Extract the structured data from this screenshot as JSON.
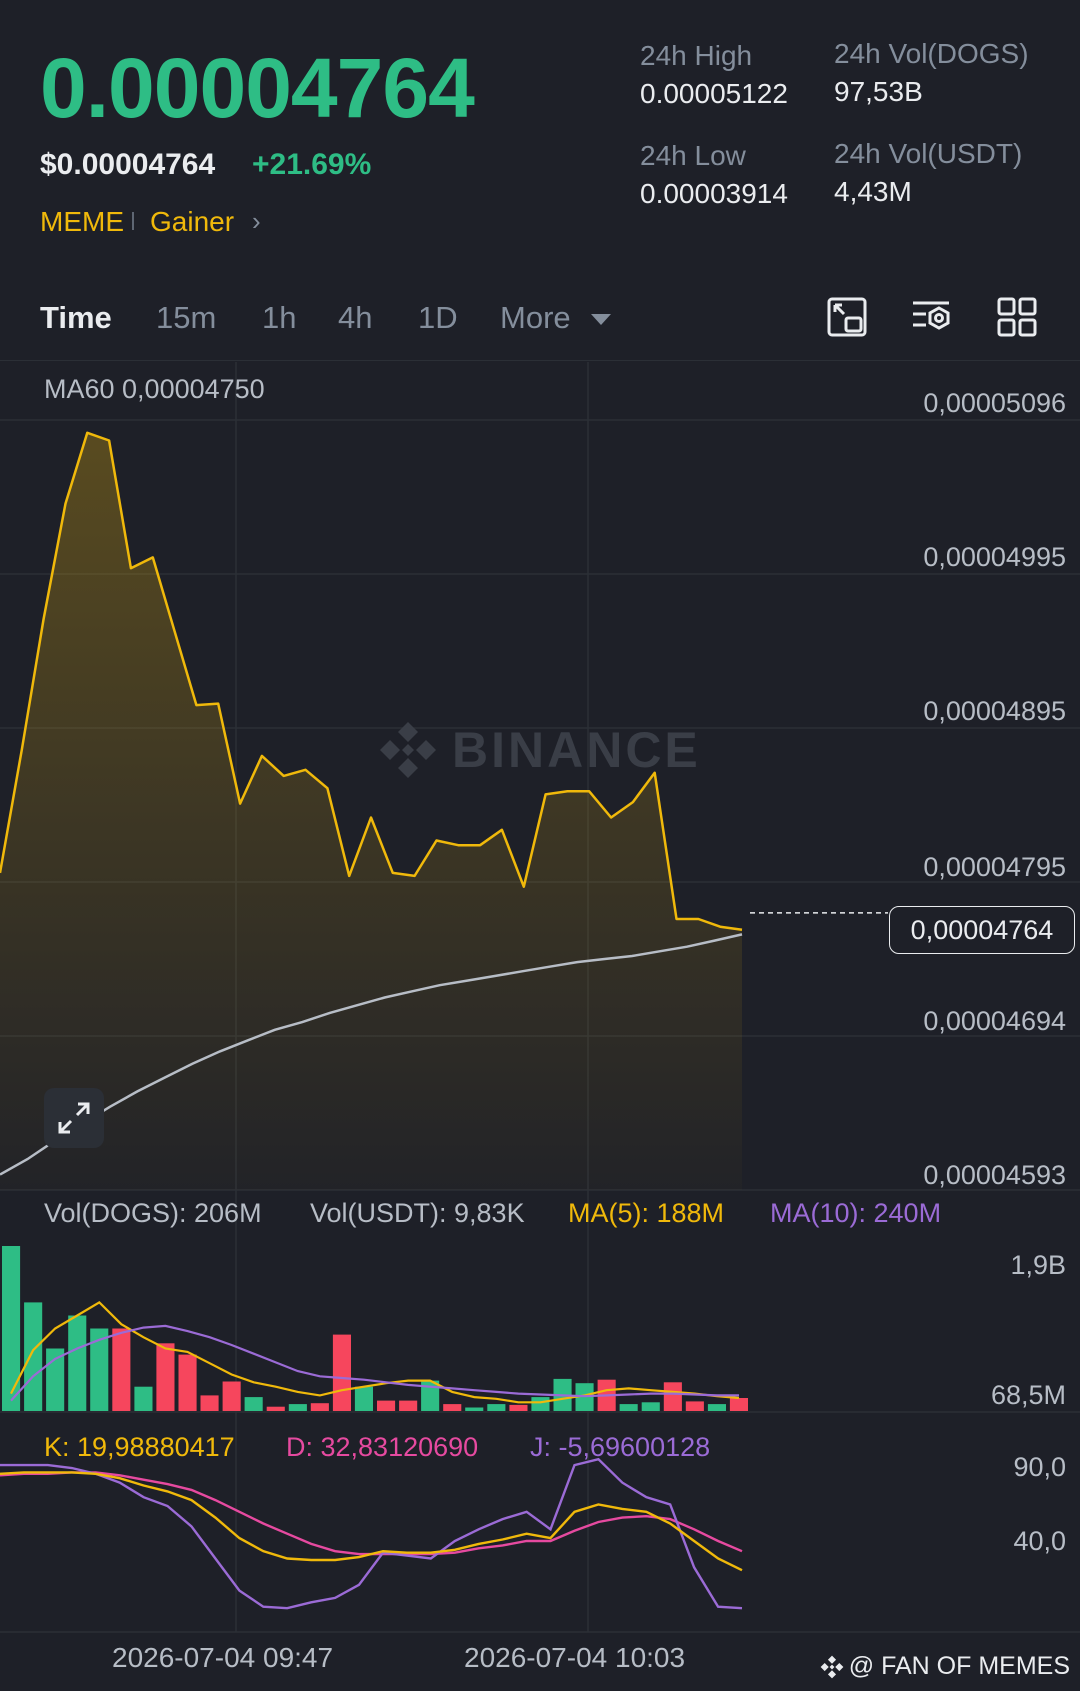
{
  "header": {
    "price": "0.00004764",
    "price_usd": "$0.00004764",
    "change": "+21.69%",
    "tags": [
      "MEME",
      "Gainer"
    ],
    "stats": {
      "high_label": "24h High",
      "high_value": "0.00005122",
      "low_label": "24h Low",
      "low_value": "0.00003914",
      "vol_base_label": "24h Vol(DOGS)",
      "vol_base_value": "97,53B",
      "vol_quote_label": "24h Vol(USDT)",
      "vol_quote_value": "4,43M"
    }
  },
  "tabs": [
    "Time",
    "15m",
    "1h",
    "4h",
    "1D",
    "More"
  ],
  "toolbar_icons": [
    "picture-in-picture-icon",
    "indicator-settings-icon",
    "grid-layout-icon"
  ],
  "chart": {
    "ma60_label": "MA60 0,00004750",
    "y_labels": [
      "0,00005096",
      "0,00004995",
      "0,00004895",
      "0,00004795",
      "0,00004694",
      "0,00004593"
    ],
    "current_price_label": "0,00004764",
    "watermark": "BINANCE",
    "volume_info": {
      "vol_base": "Vol(DOGS): 206M",
      "vol_quote": "Vol(USDT): 9,83K",
      "ma5": "MA(5): 188M",
      "ma10": "MA(10): 240M"
    },
    "volume_y_labels": [
      "1,9B",
      "68,5M"
    ],
    "kdj_info": {
      "k": "K: 19,98880417",
      "d": "D: 32,83120690",
      "j": "J: -5,69600128"
    },
    "kdj_y_labels": [
      "90,0",
      "40,0"
    ],
    "time_labels": [
      "2026-07-04 09:47",
      "2026-07-04 10:03"
    ],
    "colors": {
      "price_line": "#f0b90b",
      "ma60": "#b7bdc6",
      "up": "#2ebd85",
      "down": "#f6465d",
      "ma5": "#f0b90b",
      "ma10": "#9b6bd6",
      "k": "#f0b90b",
      "d": "#e64aa0",
      "j": "#9b6bd6"
    }
  },
  "chart_data": {
    "type": "line",
    "price_series": [
      4.79e-05,
      4.87e-05,
      4.955e-05,
      5.03e-05,
      5.076e-05,
      5.071e-05,
      4.988e-05,
      4.995e-05,
      4.947e-05,
      4.899e-05,
      4.9e-05,
      4.835e-05,
      4.866e-05,
      4.853e-05,
      4.857e-05,
      4.845e-05,
      4.788e-05,
      4.826e-05,
      4.79e-05,
      4.788e-05,
      4.811e-05,
      4.808e-05,
      4.808e-05,
      4.818e-05,
      4.781e-05,
      4.841e-05,
      4.843e-05,
      4.843e-05,
      4.826e-05,
      4.836e-05,
      4.855e-05,
      4.76e-05,
      4.76e-05,
      4.755e-05,
      4.753e-05
    ],
    "ma60_series": [
      4.594e-05,
      4.604e-05,
      4.616e-05,
      4.627e-05,
      4.638e-05,
      4.648e-05,
      4.657e-05,
      4.666e-05,
      4.674e-05,
      4.681e-05,
      4.688e-05,
      4.693e-05,
      4.699e-05,
      4.704e-05,
      4.709e-05,
      4.713e-05,
      4.717e-05,
      4.72e-05,
      4.723e-05,
      4.726e-05,
      4.729e-05,
      4.732e-05,
      4.734e-05,
      4.736e-05,
      4.739e-05,
      4.742e-05,
      4.746e-05,
      4.75e-05
    ],
    "volume_series": [
      1900000000.0,
      1250000000.0,
      720000000.0,
      1100000000.0,
      950000000.0,
      950000000.0,
      280000000.0,
      780000000.0,
      650000000.0,
      180000000.0,
      340000000.0,
      160000000.0,
      50000000.0,
      80000000.0,
      90000000.0,
      880000000.0,
      280000000.0,
      120000000.0,
      120000000.0,
      350000000.0,
      80000000.0,
      40000000.0,
      80000000.0,
      70000000.0,
      160000000.0,
      370000000.0,
      320000000.0,
      360000000.0,
      80000000.0,
      100000000.0,
      330000000.0,
      110000000.0,
      80000000.0,
      150000000.0
    ],
    "volume_up": [
      true,
      true,
      true,
      true,
      true,
      false,
      true,
      false,
      false,
      false,
      false,
      true,
      false,
      true,
      false,
      false,
      true,
      false,
      false,
      true,
      false,
      true,
      true,
      false,
      true,
      true,
      true,
      false,
      true,
      true,
      false,
      false,
      true,
      false
    ],
    "ma5_series": [
      200000000.0,
      700000000.0,
      950000000.0,
      1100000000.0,
      1250000000.0,
      1000000000.0,
      850000000.0,
      720000000.0,
      680000000.0,
      550000000.0,
      420000000.0,
      330000000.0,
      280000000.0,
      220000000.0,
      180000000.0,
      240000000.0,
      280000000.0,
      320000000.0,
      350000000.0,
      350000000.0,
      220000000.0,
      160000000.0,
      140000000.0,
      100000000.0,
      100000000.0,
      140000000.0,
      180000000.0,
      240000000.0,
      260000000.0,
      240000000.0,
      220000000.0,
      200000000.0,
      170000000.0,
      150000000.0
    ],
    "ma10_series": [
      120000000.0,
      400000000.0,
      600000000.0,
      720000000.0,
      820000000.0,
      900000000.0,
      960000000.0,
      980000000.0,
      920000000.0,
      850000000.0,
      760000000.0,
      660000000.0,
      560000000.0,
      460000000.0,
      400000000.0,
      380000000.0,
      360000000.0,
      330000000.0,
      300000000.0,
      280000000.0,
      260000000.0,
      240000000.0,
      220000000.0,
      200000000.0,
      190000000.0,
      180000000.0,
      170000000.0,
      180000000.0,
      190000000.0,
      200000000.0,
      200000000.0,
      190000000.0,
      180000000.0,
      180000000.0
    ],
    "k_series": [
      86,
      87,
      87,
      87,
      86,
      83,
      78,
      74,
      68,
      56,
      42,
      33,
      28,
      27,
      27,
      29,
      33,
      32,
      32,
      34,
      38,
      41,
      45,
      42,
      60,
      65,
      62,
      60,
      52,
      40,
      28,
      20
    ],
    "d_series": [
      85,
      86,
      86,
      87,
      87,
      85,
      82,
      79,
      75,
      68,
      60,
      52,
      45,
      38,
      33,
      31,
      31,
      31,
      31,
      32,
      35,
      37,
      40,
      40,
      47,
      53,
      56,
      57,
      55,
      48,
      40,
      33
    ],
    "j_series": [
      92,
      92,
      92,
      90,
      86,
      80,
      70,
      64,
      50,
      28,
      6,
      -5,
      -6,
      -2,
      1,
      10,
      32,
      30,
      28,
      40,
      48,
      55,
      60,
      48,
      92,
      96,
      80,
      70,
      65,
      22,
      -5,
      -6
    ]
  }
}
